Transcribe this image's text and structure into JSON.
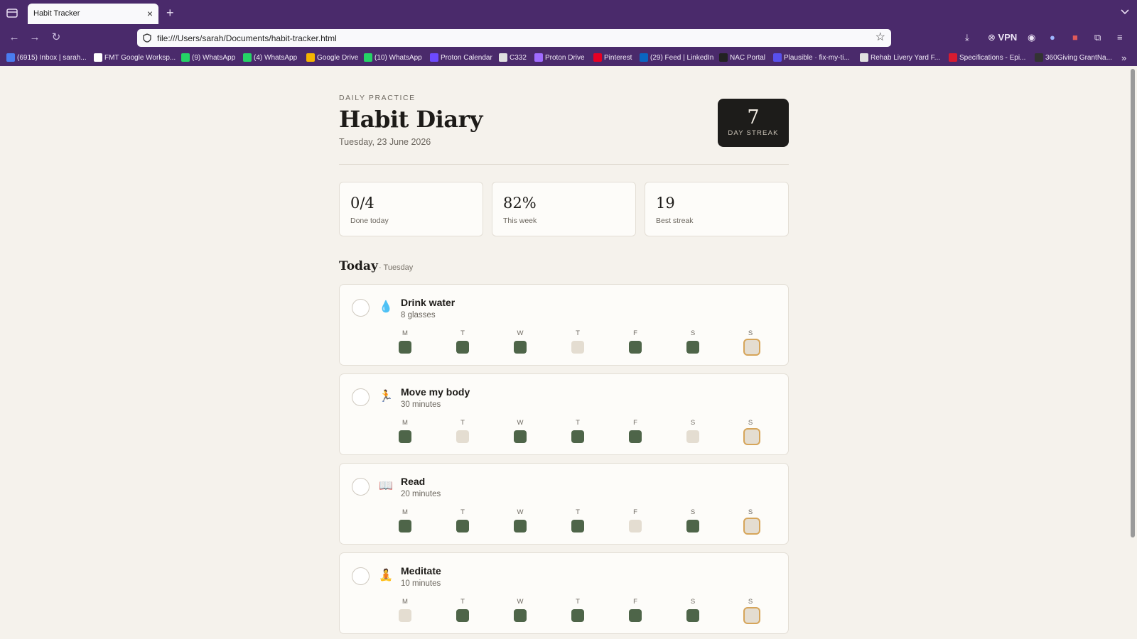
{
  "browser": {
    "tab_title": "Habit Tracker",
    "url": "file:///Users/sarah/Documents/habit-tracker.html",
    "vpn_label": "VPN",
    "bookmarks": [
      {
        "label": "(6915) Inbox | sarah...",
        "icon": "gmail-icon",
        "color": "#4a7cf0"
      },
      {
        "label": "FMT Google Worksp...",
        "icon": "google-icon",
        "color": "#ffffff"
      },
      {
        "label": "(9) WhatsApp",
        "icon": "whatsapp-icon",
        "color": "#25d366"
      },
      {
        "label": "(4) WhatsApp",
        "icon": "whatsapp-icon",
        "color": "#25d366"
      },
      {
        "label": "Google Drive",
        "icon": "google-drive-icon",
        "color": "#f4b400"
      },
      {
        "label": "(10) WhatsApp",
        "icon": "whatsapp-icon",
        "color": "#25d366"
      },
      {
        "label": "Proton Calendar",
        "icon": "proton-calendar-icon",
        "color": "#6d4aff"
      },
      {
        "label": "C332",
        "icon": "globe-icon",
        "color": "#e0e0e0"
      },
      {
        "label": "Proton Drive",
        "icon": "proton-drive-icon",
        "color": "#a06bff"
      },
      {
        "label": "Pinterest",
        "icon": "pinterest-icon",
        "color": "#e60023"
      },
      {
        "label": "(29) Feed | LinkedIn",
        "icon": "linkedin-icon",
        "color": "#0a66c2"
      },
      {
        "label": "NAC Portal",
        "icon": "nac-portal-icon",
        "color": "#222222"
      },
      {
        "label": "Plausible · fix-my-ti...",
        "icon": "plausible-icon",
        "color": "#5850ec"
      },
      {
        "label": "Rehab Livery Yard F...",
        "icon": "globe-icon",
        "color": "#e0e0e0"
      },
      {
        "label": "Specifications - Epi...",
        "icon": "drop-icon",
        "color": "#d81b30"
      },
      {
        "label": "360Giving GrantNa...",
        "icon": "giving-icon",
        "color": "#333333"
      }
    ]
  },
  "page": {
    "eyebrow": "DAILY PRACTICE",
    "title": "Habit Diary",
    "date": "Tuesday, 23 June 2026",
    "streak": {
      "value": "7",
      "label": "DAY STREAK"
    },
    "stats": [
      {
        "value": "0/4",
        "label": "Done today"
      },
      {
        "value": "82%",
        "label": "This week"
      },
      {
        "value": "19",
        "label": "Best streak"
      }
    ],
    "section_title": "Today",
    "section_sub": "· Tuesday",
    "day_letters": [
      "M",
      "T",
      "W",
      "T",
      "F",
      "S",
      "S"
    ],
    "habits": [
      {
        "name": "Drink water",
        "goal": "8 glasses",
        "emoji": "💧",
        "icon": "water-drop-icon",
        "week": [
          1,
          1,
          1,
          0,
          1,
          1,
          2
        ]
      },
      {
        "name": "Move my body",
        "goal": "30 minutes",
        "emoji": "🏃",
        "icon": "runner-icon",
        "week": [
          1,
          0,
          1,
          1,
          1,
          0,
          2
        ]
      },
      {
        "name": "Read",
        "goal": "20 minutes",
        "emoji": "📖",
        "icon": "book-icon",
        "week": [
          1,
          1,
          1,
          1,
          0,
          1,
          2
        ]
      },
      {
        "name": "Meditate",
        "goal": "10 minutes",
        "emoji": "🧘",
        "icon": "meditation-icon",
        "week": [
          0,
          1,
          1,
          1,
          1,
          1,
          2
        ]
      }
    ]
  },
  "colors": {
    "browser_chrome": "#4a2a6b",
    "page_bg": "#f5f2ec",
    "done": "#4e6549",
    "missed": "#e4ddd1",
    "today_outline": "#d6a55a"
  }
}
